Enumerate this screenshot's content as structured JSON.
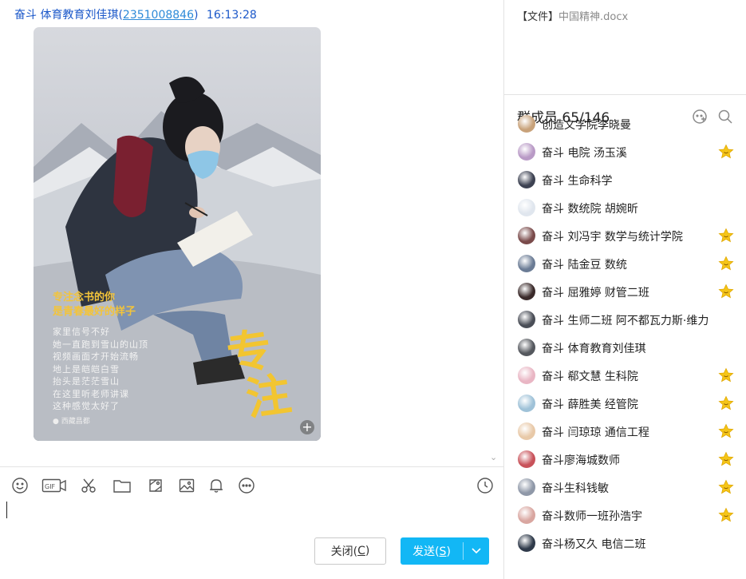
{
  "message": {
    "sender": "奋斗 体育教育刘佳琪",
    "open_paren": "(",
    "sender_id": "2351008846",
    "close_paren": ")",
    "time": "16:13:28"
  },
  "photo": {
    "headline": [
      "专注念书的你",
      "是青春最好的样子"
    ],
    "poem": [
      "家里信号不好",
      "她一直跑到雪山的山顶",
      "视频画面才开始流畅",
      "地上是皑皑白雪",
      "抬头是茫茫雪山",
      "在这里听老师讲课",
      "这种感觉太好了"
    ],
    "big_text": [
      "专",
      "注"
    ],
    "location": "西藏昌都"
  },
  "toolbar": {
    "icons": [
      "emoji-icon",
      "gif-icon",
      "scissors-icon",
      "folder-icon",
      "screenshot-icon",
      "image-icon",
      "bell-icon",
      "more-icon",
      "history-clock-icon"
    ],
    "gif_label": "GIF"
  },
  "buttons": {
    "close_text": "关闭(",
    "close_key": "C",
    "close_end": ")",
    "send_text": "发送(",
    "send_key": "S",
    "send_end": ")"
  },
  "files": {
    "prefix": "【文件】",
    "name": "中国精神.docx"
  },
  "members": {
    "title": "群成员 65/146",
    "list": [
      {
        "name": "创造文学院李晓曼",
        "avatar_color": "#c8a27a",
        "star": false
      },
      {
        "name": "奋斗  电院 汤玉溪",
        "avatar_color": "#b99ac6",
        "star": true
      },
      {
        "name": "奋斗  生命科学",
        "avatar_color": "#3d4252",
        "star": false
      },
      {
        "name": "奋斗  数统院 胡婉昕",
        "avatar_color": "#e0e6ee",
        "star": false
      },
      {
        "name": "奋斗 刘冯宇 数学与统计学院",
        "avatar_color": "#7a4b4b",
        "star": true
      },
      {
        "name": "奋斗 陆金豆  数统",
        "avatar_color": "#6b7c95",
        "star": true
      },
      {
        "name": "奋斗 屈雅婷 财管二班",
        "avatar_color": "#3a2a2a",
        "star": true
      },
      {
        "name": "奋斗 生师二班 阿不都瓦力斯·维力",
        "avatar_color": "#4a4e57",
        "star": false
      },
      {
        "name": "奋斗 体育教育刘佳琪",
        "avatar_color": "#55585e",
        "star": false
      },
      {
        "name": "奋斗 郗文慧 生科院",
        "avatar_color": "#e9b6c4",
        "star": true
      },
      {
        "name": "奋斗 薛胜美 经管院",
        "avatar_color": "#9fc2d8",
        "star": true
      },
      {
        "name": "奋斗 闫琼琼 通信工程",
        "avatar_color": "#e8c9a8",
        "star": true
      },
      {
        "name": "奋斗廖海城数师",
        "avatar_color": "#c8525a",
        "star": true
      },
      {
        "name": "奋斗生科钱敏",
        "avatar_color": "#8f98a8",
        "star": true
      },
      {
        "name": "奋斗数师一班孙浩宇",
        "avatar_color": "#d9a6a0",
        "star": true
      },
      {
        "name": "奋斗杨又久 电信二班",
        "avatar_color": "#2f3a4a",
        "star": false
      }
    ]
  },
  "colors": {
    "accent": "#12b7f5",
    "link": "#1a57c9",
    "star": "#f5c518"
  }
}
